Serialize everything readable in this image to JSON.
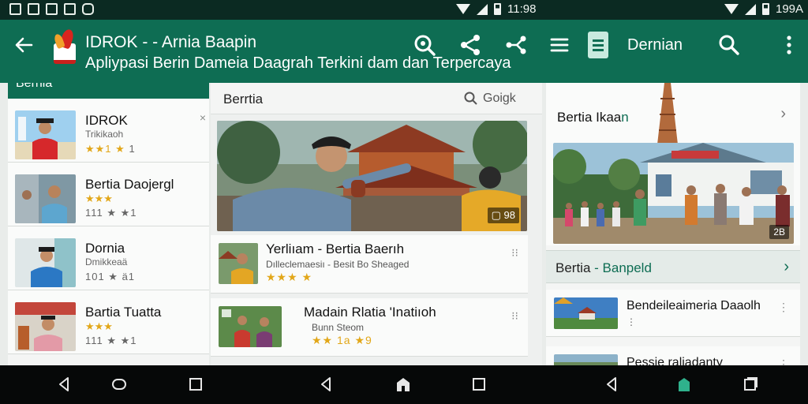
{
  "status": {
    "time_left": "11:98",
    "time_right": "199A"
  },
  "appbar": {
    "title": "IDROK - - Arnia Baapin",
    "subtitle": "Apliypasi Berin Dameia Daagrah Terkini dam dan Terpercaya",
    "right_title": "Dernian"
  },
  "panel_left": {
    "header": "Bernia",
    "items": [
      {
        "title": "IDROK",
        "subtitle": "Trikikaoh",
        "stars_filled": "★★1 ★",
        "stars_rest": "1"
      },
      {
        "title": "Bertia Daojergl",
        "subtitle": "★★★",
        "stars_filled": "",
        "stars_rest": "1‌11 ★ ★1"
      },
      {
        "title": "Dornia",
        "subtitle": "Dmikkeaä",
        "stars_filled": "",
        "stars_rest": "1‌01 ★ ä1"
      },
      {
        "title": "Bartia Tuatta",
        "subtitle": "★★★",
        "stars_filled": "",
        "stars_rest": "1‌11 ★ ★1"
      }
    ]
  },
  "panel_middle": {
    "header": "Berrtia",
    "search": "Goigk",
    "hero_badge": "▢ 98",
    "cards": [
      {
        "title": "Yerliıam - Bertia Baerıh",
        "subtitle": "Dılleclemaesiı - Besit Bo Sheaged",
        "stars": "★★★ ★"
      },
      {
        "title": "Madain Rlatia 'Inatiıoh",
        "subtitle": "Bunn Steom",
        "stars": "★★ 1a ★9"
      }
    ]
  },
  "panel_right": {
    "header_main": "Bertia Ikaa",
    "header_accent": "n",
    "scene_badge": "2B",
    "section_main": "Bertia",
    "section_accent": " - Banpeld",
    "rows": [
      {
        "title": "Bendeileaimeria Daaolh"
      },
      {
        "title": "Pessie raliadanty"
      }
    ]
  },
  "colors": {
    "primary": "#0e6d53",
    "statusbar": "#0b2a22",
    "star": "#e2a719",
    "nav_active": "#2fb18c"
  }
}
